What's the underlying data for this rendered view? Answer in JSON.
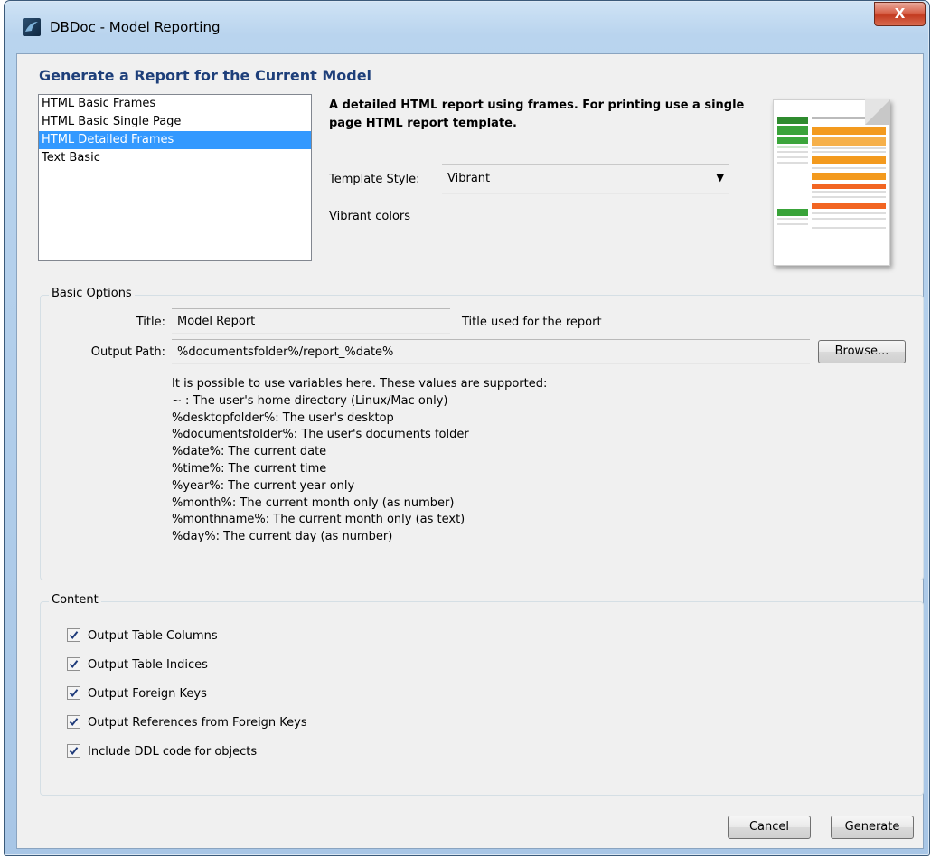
{
  "window": {
    "title": "DBDoc - Model Reporting",
    "close_glyph": "X"
  },
  "heading": "Generate a Report for the Current Model",
  "templates": {
    "items": [
      {
        "label": "HTML Basic Frames"
      },
      {
        "label": "HTML Basic Single Page"
      },
      {
        "label": "HTML Detailed Frames"
      },
      {
        "label": "Text Basic"
      }
    ],
    "selected_index": 2
  },
  "template_description": "A detailed HTML report using frames. For printing use a single page HTML report template.",
  "template_style": {
    "label": "Template Style:",
    "value": "Vibrant",
    "description": "Vibrant colors"
  },
  "basic_options": {
    "group_label": "Basic Options",
    "title_label": "Title:",
    "title_value": "Model Report",
    "title_hint": "Title used for the report",
    "output_label": "Output Path:",
    "output_value": "%documentsfolder%/report_%date%",
    "browse_label": "Browse...",
    "variables": [
      "It is possible to use variables here. These values are supported:",
      "~ : The user's home directory (Linux/Mac only)",
      "%desktopfolder%: The user's desktop",
      "%documentsfolder%: The user's documents folder",
      "%date%: The current date",
      "%time%: The current time",
      "%year%: The current year only",
      "%month%: The current month only (as number)",
      "%monthname%: The current month only (as text)",
      "%day%: The current day (as number)"
    ]
  },
  "content": {
    "group_label": "Content",
    "options": [
      {
        "label": "Output Table Columns",
        "checked": true
      },
      {
        "label": "Output Table Indices",
        "checked": true
      },
      {
        "label": "Output Foreign Keys",
        "checked": true
      },
      {
        "label": "Output References from Foreign Keys",
        "checked": true
      },
      {
        "label": "Include DDL code for objects",
        "checked": true
      }
    ]
  },
  "footer": {
    "cancel_label": "Cancel",
    "generate_label": "Generate"
  },
  "colors": {
    "selection": "#3399ff",
    "heading": "#1e3f7a",
    "close_button": "#c33b20"
  }
}
